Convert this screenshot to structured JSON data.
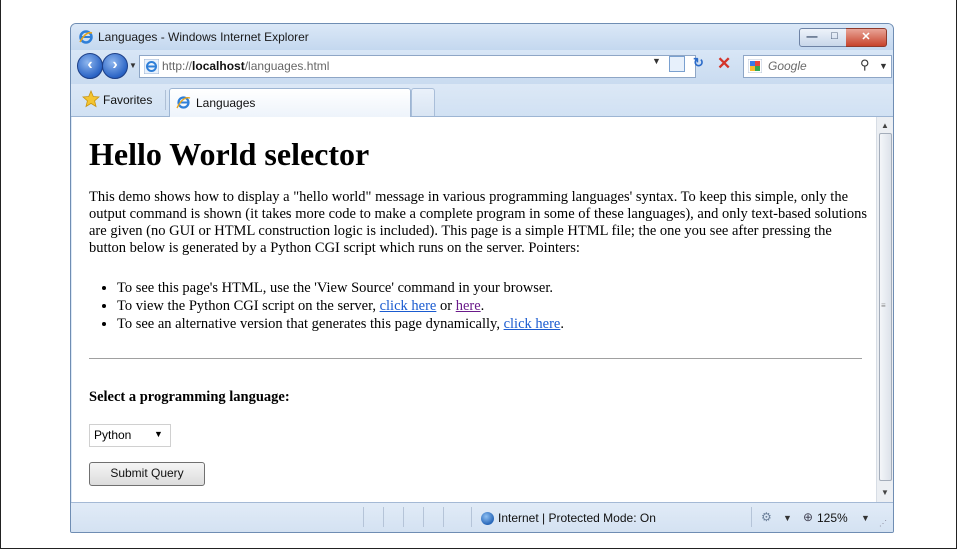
{
  "window": {
    "title": "Languages - Windows Internet Explorer",
    "minimize_glyph": "—",
    "maximize_glyph": "□",
    "close_glyph": "✕"
  },
  "nav": {
    "url_prefix": "http://",
    "url_host": "localhost",
    "url_path": "/languages.html",
    "search_placeholder": "Google"
  },
  "tabs": {
    "favorites_label": "Favorites",
    "active_tab_label": "Languages"
  },
  "page": {
    "heading": "Hello World selector",
    "description": "This demo shows how to display a \"hello world\" message in various programming languages' syntax. To keep this simple, only the output command is shown (it takes more code to make a complete program in some of these languages), and only text-based solutions are given (no GUI or HTML construction logic is included). This page is a simple HTML file; the one you see after pressing the button below is generated by a Python CGI script which runs on the server. Pointers:",
    "pointers": [
      {
        "text": "To see this page's HTML, use the 'View Source' command in your browser."
      },
      {
        "text_before": "To view the Python CGI script on the server, ",
        "link1": "click here",
        "middle": " or ",
        "link2": "here",
        "text_after": "."
      },
      {
        "text_before": "To see an alternative version that generates this page dynamically, ",
        "link1": "click here",
        "text_after": "."
      }
    ],
    "select_label": "Select a programming language:",
    "selected_language": "Python",
    "submit_label": "Submit Query"
  },
  "status": {
    "zone": "Internet | Protected Mode: On",
    "zoom": "125%"
  },
  "colors": {
    "link": "#1a5bd0",
    "visited_link": "#6a1a8a",
    "chrome_blue": "#cfe0f3"
  }
}
